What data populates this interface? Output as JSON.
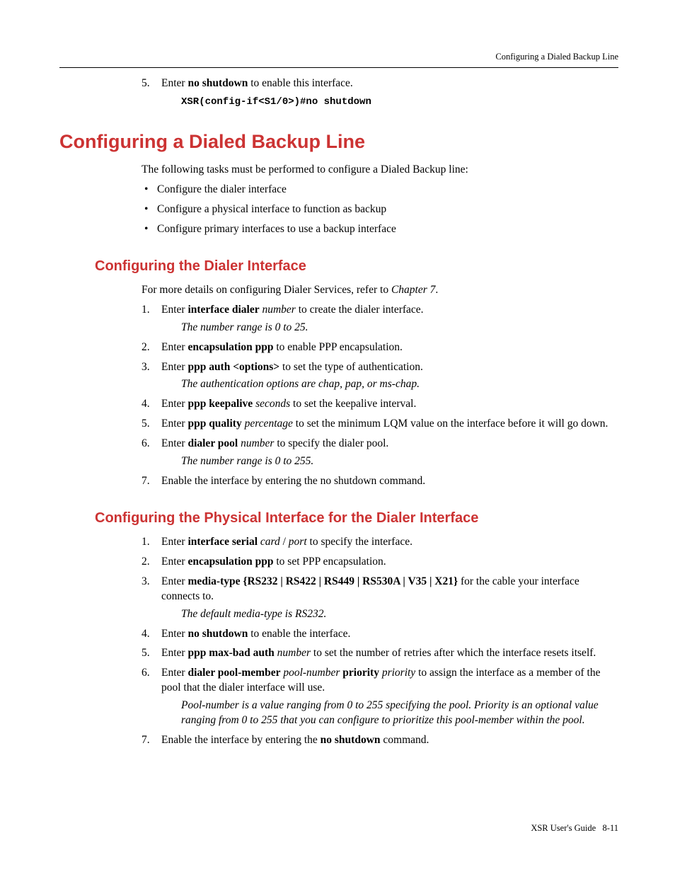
{
  "header": {
    "running": "Configuring a Dialed Backup Line"
  },
  "top": {
    "step5_num": "5.",
    "step5_a": "Enter ",
    "step5_b": "no shutdown",
    "step5_c": " to enable this interface.",
    "code": "XSR(config-if<S1/0>)#no shutdown"
  },
  "h1": "Configuring a Dialed Backup Line",
  "intro": "The following tasks must be performed to configure a Dialed Backup line:",
  "bullets": [
    "Configure the dialer interface",
    "Configure a physical interface to function as backup",
    "Configure primary interfaces to use a backup interface"
  ],
  "sec1": {
    "title": "Configuring the Dialer Interface",
    "lead_a": "For more details on configuring Dialer Services, refer to ",
    "lead_b": "Chapter 7",
    "lead_c": ".",
    "steps": [
      {
        "num": "1.",
        "parts": [
          "Enter ",
          "interface dialer",
          " ",
          "number",
          " to create the dialer interface."
        ],
        "bold": [
          false,
          true,
          false,
          false,
          false
        ],
        "ital": [
          false,
          false,
          false,
          true,
          false
        ],
        "note": "The number range is 0 to 25."
      },
      {
        "num": "2.",
        "parts": [
          "Enter ",
          "encapsulation ppp",
          " to enable PPP encapsulation."
        ],
        "bold": [
          false,
          true,
          false
        ],
        "ital": [
          false,
          false,
          false
        ]
      },
      {
        "num": "3.",
        "parts": [
          "Enter ",
          "ppp auth <options>",
          " to set the type of authentication."
        ],
        "bold": [
          false,
          true,
          false
        ],
        "ital": [
          false,
          false,
          false
        ],
        "note": "The authentication options are chap, pap, or ms-chap."
      },
      {
        "num": "4.",
        "parts": [
          "Enter ",
          "ppp keepalive",
          " ",
          "seconds",
          " to set the keepalive interval."
        ],
        "bold": [
          false,
          true,
          false,
          false,
          false
        ],
        "ital": [
          false,
          false,
          false,
          true,
          false
        ]
      },
      {
        "num": "5.",
        "parts": [
          "Enter ",
          "ppp quality",
          " ",
          "percentage",
          " to set the minimum LQM value on the interface before it will go down."
        ],
        "bold": [
          false,
          true,
          false,
          false,
          false
        ],
        "ital": [
          false,
          false,
          false,
          true,
          false
        ]
      },
      {
        "num": "6.",
        "parts": [
          "Enter ",
          "dialer pool",
          " ",
          "number",
          " to specify the dialer pool."
        ],
        "bold": [
          false,
          true,
          false,
          false,
          false
        ],
        "ital": [
          false,
          false,
          false,
          true,
          false
        ],
        "note": "The number range is 0 to 255."
      },
      {
        "num": "7.",
        "parts": [
          "Enable the interface by entering the no shutdown command."
        ],
        "bold": [
          false
        ],
        "ital": [
          false
        ]
      }
    ]
  },
  "sec2": {
    "title": "Configuring the Physical Interface for the Dialer Interface",
    "steps": [
      {
        "num": "1.",
        "parts": [
          "Enter ",
          "interface serial",
          " ",
          "card",
          " / ",
          "port",
          " to specify the interface."
        ],
        "bold": [
          false,
          true,
          false,
          false,
          false,
          false,
          false
        ],
        "ital": [
          false,
          false,
          false,
          true,
          false,
          true,
          false
        ]
      },
      {
        "num": "2.",
        "parts": [
          "Enter ",
          "encapsulation ppp",
          " to set PPP encapsulation."
        ],
        "bold": [
          false,
          true,
          false
        ],
        "ital": [
          false,
          false,
          false
        ]
      },
      {
        "num": "3.",
        "parts": [
          "Enter ",
          "media-type {RS232 | RS422 | RS449 | RS530A | V35 | X21}",
          "  for the cable your interface connects to."
        ],
        "bold": [
          false,
          true,
          false
        ],
        "ital": [
          false,
          false,
          false
        ],
        "note": "The default media-type is RS232."
      },
      {
        "num": "4.",
        "parts": [
          "Enter ",
          "no shutdown",
          " to enable the interface."
        ],
        "bold": [
          false,
          true,
          false
        ],
        "ital": [
          false,
          false,
          false
        ]
      },
      {
        "num": "5.",
        "parts": [
          "Enter ",
          "ppp max-bad auth",
          " ",
          "number",
          " to set the number of retries after which the interface resets itself."
        ],
        "bold": [
          false,
          true,
          false,
          false,
          false
        ],
        "ital": [
          false,
          false,
          false,
          true,
          false
        ]
      },
      {
        "num": "6.",
        "parts": [
          "Enter ",
          "dialer pool-member",
          " ",
          "pool-number",
          " ",
          "priority",
          " ",
          "priority",
          " to assign the interface as a member of the pool that the dialer interface will use."
        ],
        "bold": [
          false,
          true,
          false,
          false,
          false,
          true,
          false,
          false,
          false
        ],
        "ital": [
          false,
          false,
          false,
          true,
          false,
          false,
          false,
          true,
          false
        ],
        "note": "Pool-number is a value ranging from 0 to 255 specifying the pool. Priority is an optional value ranging from 0 to 255 that you can configure to prioritize this pool-member within the pool."
      },
      {
        "num": "7.",
        "parts": [
          "Enable the interface by entering the ",
          "no shutdown",
          " command."
        ],
        "bold": [
          false,
          true,
          false
        ],
        "ital": [
          false,
          false,
          false
        ]
      }
    ]
  },
  "footer": {
    "left": "XSR User's Guide",
    "right": "8-11"
  }
}
